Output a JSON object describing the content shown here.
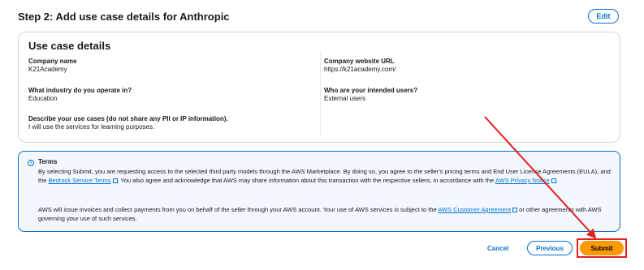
{
  "header": {
    "title": "Step 2: Add use case details for Anthropic",
    "edit_label": "Edit"
  },
  "card": {
    "title": "Use case details",
    "company_name": {
      "label": "Company name",
      "value": "K21Academy"
    },
    "company_url": {
      "label": "Company website URL",
      "value": "https://k21academy.com/"
    },
    "industry": {
      "label": "What industry do you operate in?",
      "value": "Education"
    },
    "intended_users": {
      "label": "Who are your intended users?",
      "value": "External users"
    },
    "use_cases": {
      "label": "Describe your use cases (do not share any PII or IP information).",
      "value": "I will use the services for learning purposes."
    }
  },
  "terms": {
    "icon": "info-icon",
    "title": "Terms",
    "p1_part1": "By selecting Submit, you are requesting access to the selected third party models through the AWS Marketplace. By doing so, you agree to the seller's pricing terms and End User License Agreements (EULA), and the ",
    "p1_link1": "Bedrock Service Terms",
    "p1_part2": ". You also agree and acknowledge that AWS may share information about this transaction with the respective sellers, in accordance with the ",
    "p1_link2": "AWS Privacy Notice",
    "p1_part3": ".",
    "p2_part1": "AWS will issue invoices and collect payments from you on behalf of the seller through your AWS account. Your use of AWS services is subject to the ",
    "p2_link1": "AWS Customer Agreement",
    "p2_part2": " or other agreements with AWS governing your use of such services."
  },
  "footer": {
    "cancel_label": "Cancel",
    "previous_label": "Previous",
    "submit_label": "Submit"
  },
  "colors": {
    "accent": "#0972d3",
    "submit": "#ff9900",
    "annotation": "#e02020"
  }
}
